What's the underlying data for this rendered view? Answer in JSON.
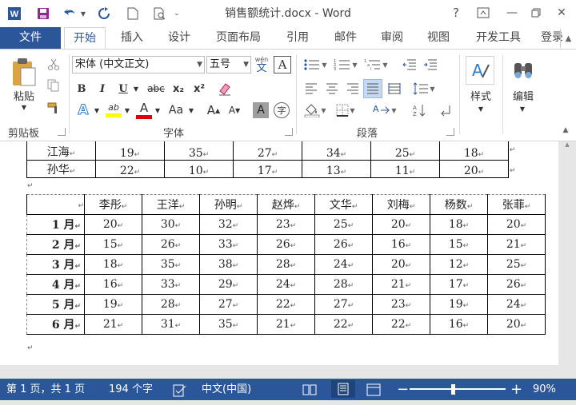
{
  "titlebar": {
    "title": "销售额统计.docx - Word",
    "help": "?",
    "minimize": "—",
    "close": "✕"
  },
  "tabs": [
    {
      "label": "文件"
    },
    {
      "label": "开始"
    },
    {
      "label": "插入"
    },
    {
      "label": "设计"
    },
    {
      "label": "页面布局"
    },
    {
      "label": "引用"
    },
    {
      "label": "邮件"
    },
    {
      "label": "审阅"
    },
    {
      "label": "视图"
    },
    {
      "label": "开发工具"
    },
    {
      "label": "登录"
    }
  ],
  "ribbon": {
    "clipboard": {
      "paste_label": "粘贴",
      "group_label": "剪贴板"
    },
    "font": {
      "font_name": "宋体 (中文正文)",
      "font_size": "五号",
      "pinyin_top": "wén",
      "pinyin_char": "文",
      "boxed_char": "A",
      "bold": "B",
      "italic": "I",
      "underline": "U",
      "strike": "abc",
      "subscript": "x₂",
      "superscript": "x²",
      "text_effects": "A",
      "highlight": "ab",
      "font_color": "A",
      "change_case": "Aa",
      "grow": "A",
      "shrink": "A",
      "char_shading": "A",
      "enclose": "字",
      "group_label": "字体"
    },
    "paragraph": {
      "group_label": "段落"
    },
    "styles": {
      "label": "样式"
    },
    "editing": {
      "label": "编辑"
    }
  },
  "table1": {
    "rows": [
      {
        "name": "江海",
        "values": [
          "19",
          "35",
          "27",
          "34",
          "25",
          "18"
        ]
      },
      {
        "name": "孙华",
        "values": [
          "22",
          "10",
          "17",
          "13",
          "11",
          "20"
        ]
      }
    ]
  },
  "table2": {
    "headers": [
      "李彤",
      "王洋",
      "孙明",
      "赵烨",
      "文华",
      "刘梅",
      "杨数",
      "张菲"
    ],
    "rows": [
      {
        "month": "1 月",
        "values": [
          "20",
          "30",
          "32",
          "23",
          "25",
          "20",
          "18",
          "20"
        ]
      },
      {
        "month": "2 月",
        "values": [
          "15",
          "26",
          "33",
          "26",
          "26",
          "16",
          "15",
          "21"
        ]
      },
      {
        "month": "3 月",
        "values": [
          "18",
          "35",
          "38",
          "28",
          "24",
          "20",
          "12",
          "25"
        ]
      },
      {
        "month": "4 月",
        "values": [
          "16",
          "33",
          "29",
          "24",
          "28",
          "21",
          "17",
          "26"
        ]
      },
      {
        "month": "5 月",
        "values": [
          "19",
          "28",
          "27",
          "22",
          "27",
          "23",
          "19",
          "24"
        ]
      },
      {
        "month": "6 月",
        "values": [
          "21",
          "31",
          "35",
          "21",
          "22",
          "22",
          "16",
          "20"
        ]
      }
    ]
  },
  "statusbar": {
    "page": "第 1 页，共 1 页",
    "words": "194 个字",
    "language": "中文(中国)",
    "zoom": "90%",
    "zoom_level": 0.9
  },
  "colors": {
    "accent": "#2b579a",
    "highlight": "#ffff00",
    "font_color_bar": "#e00000"
  }
}
